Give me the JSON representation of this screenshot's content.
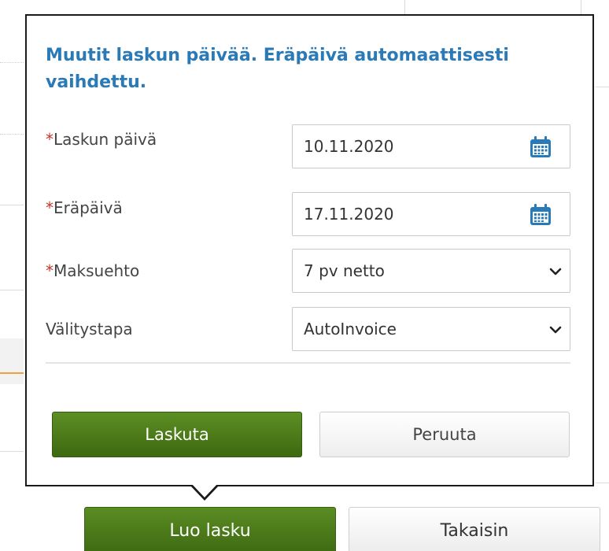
{
  "popover": {
    "notice": "Muutit laskun päivää. Eräpäivä automaattisesti vaihdettu.",
    "required_mark": "*",
    "fields": [
      {
        "label": "Laskun päivä",
        "value": "10.11.2020",
        "required": true,
        "kind": "date",
        "icon": "calendar-icon"
      },
      {
        "label": "Eräpäivä",
        "value": "17.11.2020",
        "required": true,
        "kind": "date",
        "icon": "calendar-icon"
      },
      {
        "label": "Maksuehto",
        "value": "7 pv netto",
        "required": true,
        "kind": "select",
        "icon": "chevron-down-icon"
      },
      {
        "label": "Välitystapa",
        "value": "AutoInvoice",
        "required": false,
        "kind": "select",
        "icon": "chevron-down-icon"
      }
    ],
    "submit_label": "Laskuta",
    "cancel_label": "Peruuta"
  },
  "page": {
    "create_invoice_label": "Luo lasku",
    "back_label": "Takaisin"
  },
  "colors": {
    "notice": "#2a7ab8",
    "required": "#c0392b",
    "primary_button": "#4a7a18",
    "calendar_icon": "#2a7ab8"
  }
}
